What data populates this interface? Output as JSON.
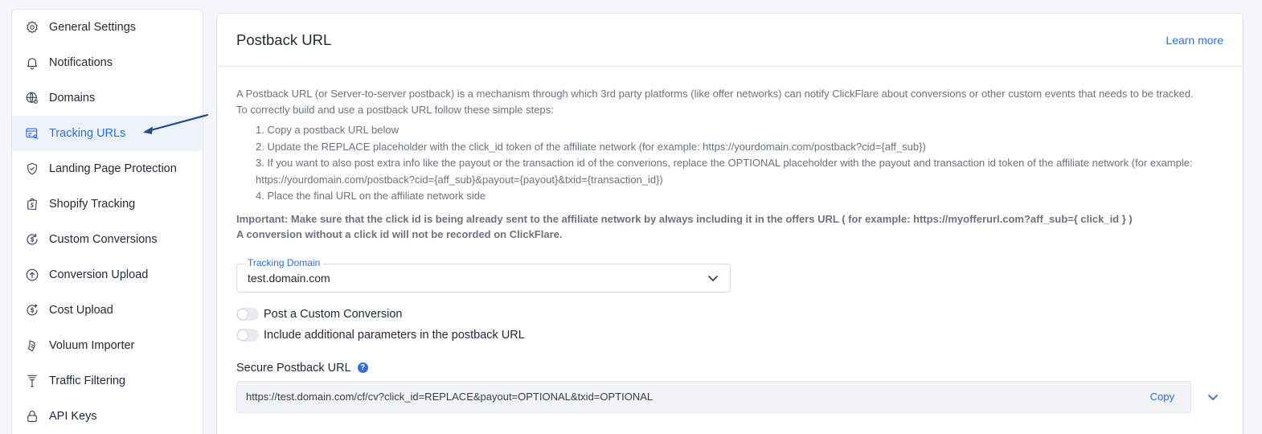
{
  "sidebar": {
    "items": [
      {
        "label": "General Settings",
        "icon": "gear-icon"
      },
      {
        "label": "Notifications",
        "icon": "bell-icon"
      },
      {
        "label": "Domains",
        "icon": "globe-icon"
      },
      {
        "label": "Tracking URLs",
        "icon": "tracking-browser-icon",
        "active": true
      },
      {
        "label": "Landing Page Protection",
        "icon": "shield-check-icon"
      },
      {
        "label": "Shopify Tracking",
        "icon": "shopify-bag-icon"
      },
      {
        "label": "Custom Conversions",
        "icon": "dollar-refresh-icon"
      },
      {
        "label": "Conversion Upload",
        "icon": "upload-circle-icon"
      },
      {
        "label": "Cost Upload",
        "icon": "dollar-upload-icon"
      },
      {
        "label": "Voluum Importer",
        "icon": "import-icon"
      },
      {
        "label": "Traffic Filtering",
        "icon": "filter-icon"
      },
      {
        "label": "API Keys",
        "icon": "lock-icon"
      }
    ]
  },
  "main": {
    "title": "Postback URL",
    "learn_more": "Learn more",
    "description_1": "A Postback URL (or Server-to-server postback) is a mechanism through which 3rd party platforms (like offer networks) can notify ClickFlare about conversions or other custom events that needs to be tracked.",
    "description_2": "To correctly build and use a postback URL follow these simple steps:",
    "steps": [
      "1. Copy a postback URL below",
      "2. Update the REPLACE placeholder with the click_id token of the affiliate network (for example: https://yourdomain.com/postback?cid={aff_sub})",
      "3. If you want to also post extra info like the payout or the transaction id of the converions, replace the OPTIONAL placeholder with the payout and transaction id token of the affiliate network (for example: https://yourdomain.com/postback?cid={aff_sub}&payout={payout}&txid={transaction_id})",
      "4. Place the final URL on the affiliate network side"
    ],
    "important_1": "Important: Make sure that the click id is being already sent to the affiliate network by always including it in the offers URL ( for example: https://myofferurl.com?aff_sub={ click_id } )",
    "important_2": "A conversion without a click id will not be recorded on ClickFlare.",
    "tracking_domain": {
      "label": "Tracking Domain",
      "value": "test.domain.com"
    },
    "toggles": [
      {
        "label": "Post a Custom Conversion",
        "on": false
      },
      {
        "label": "Include additional parameters in the postback URL",
        "on": false
      }
    ],
    "secure_postback": {
      "label": "Secure Postback URL",
      "help": "?",
      "url": "https://test.domain.com/cf/cv?click_id=REPLACE&payout=OPTIONAL&txid=OPTIONAL",
      "copy_label": "Copy"
    }
  },
  "colors": {
    "accent": "#2f6fd6",
    "annotation_arrow": "#1f4e8c"
  }
}
